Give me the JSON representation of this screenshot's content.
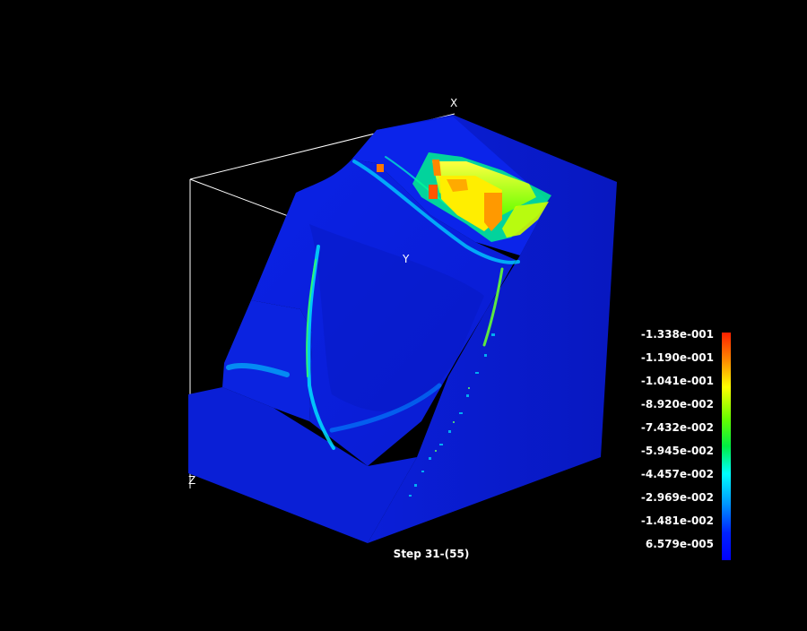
{
  "viewer": {
    "axes": {
      "x_label": "X",
      "y_label": "Y",
      "z_label": "Z"
    },
    "step_label": "Step 31-(55)",
    "colorbar": {
      "ticks": [
        "-1.338e-001",
        "-1.190e-001",
        "-1.041e-001",
        "-8.920e-002",
        "-7.432e-002",
        "-5.945e-002",
        "-4.457e-002",
        "-2.969e-002",
        "-1.481e-002",
        "6.579e-005"
      ],
      "colors": [
        "#ff2000",
        "#ffb000",
        "#ffff00",
        "#66ff00",
        "#00ee44",
        "#00ffff",
        "#0099ff",
        "#0022ff",
        "#0000ff"
      ]
    },
    "colors": {
      "background": "#000000",
      "model_base": "#0a1fd8",
      "model_side": "#081ab8",
      "model_top": "#0c22e6"
    }
  }
}
